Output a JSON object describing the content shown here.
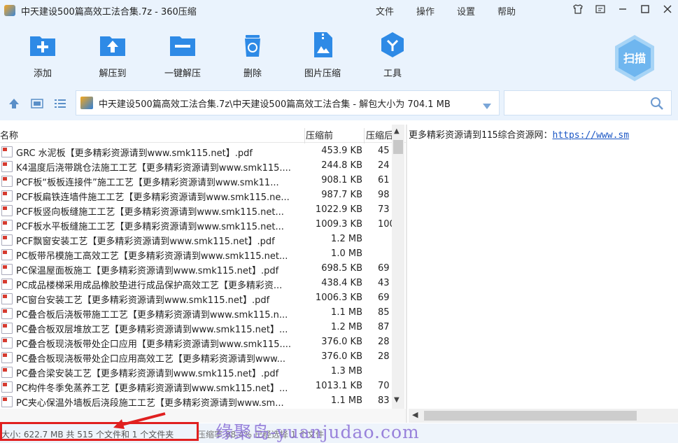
{
  "window": {
    "title": "中天建设500篇高效工法合集.7z - 360压缩"
  },
  "menu": [
    "文件",
    "操作",
    "设置",
    "帮助"
  ],
  "toolbar": {
    "buttons": [
      {
        "label": "添加",
        "icon": "add-icon"
      },
      {
        "label": "解压到",
        "icon": "extract-to-icon"
      },
      {
        "label": "一键解压",
        "icon": "quick-extract-icon"
      },
      {
        "label": "删除",
        "icon": "delete-icon"
      },
      {
        "label": "图片压缩",
        "icon": "image-compress-icon"
      },
      {
        "label": "工具",
        "icon": "tools-icon"
      }
    ],
    "scan_label": "扫描"
  },
  "address": {
    "path": "中天建设500篇高效工法合集.7z\\中天建设500篇高效工法合集 - 解包大小为 704.1 MB",
    "search_value": ""
  },
  "list": {
    "columns": {
      "name": "名称",
      "size": "压缩前",
      "packed": "压缩后"
    },
    "rows": [
      {
        "name": "GRC 水泥板【更多精彩资源请到www.smk115.net】.pdf",
        "size": "453.9 KB",
        "packed": "45"
      },
      {
        "name": "K4温度后浇带跳仓法施工工艺【更多精彩资源请到www.smk115....",
        "size": "244.8 KB",
        "packed": "24"
      },
      {
        "name": "PCF板“板板连接件”施工工艺【更多精彩资源请到www.smk11...",
        "size": "908.1 KB",
        "packed": "61"
      },
      {
        "name": "PCF板扁铁连墙件施工工艺【更多精彩资源请到www.smk115.ne...",
        "size": "987.7 KB",
        "packed": "98"
      },
      {
        "name": "PCF板竖向板缝施工工艺【更多精彩资源请到www.smk115.net...",
        "size": "1022.9 KB",
        "packed": "73"
      },
      {
        "name": "PCF板水平板缝施工工艺【更多精彩资源请到www.smk115.net...",
        "size": "1009.3 KB",
        "packed": "100"
      },
      {
        "name": "PCF飘窗安装工艺【更多精彩资源请到www.smk115.net】.pdf",
        "size": "1.2 MB",
        "packed": ""
      },
      {
        "name": "PC板带吊模施工高效工艺【更多精彩资源请到www.smk115.net...",
        "size": "1.0 MB",
        "packed": ""
      },
      {
        "name": "PC保温屋面板施工【更多精彩资源请到www.smk115.net】.pdf",
        "size": "698.5 KB",
        "packed": "69"
      },
      {
        "name": "PC成品楼梯采用成品橡胶垫进行成品保护高效工艺【更多精彩资...",
        "size": "438.4 KB",
        "packed": "43"
      },
      {
        "name": "PC窗台安装工艺【更多精彩资源请到www.smk115.net】.pdf",
        "size": "1006.3 KB",
        "packed": "69"
      },
      {
        "name": "PC叠合板后浇板带施工工艺【更多精彩资源请到www.smk115.n...",
        "size": "1.1 MB",
        "packed": "85"
      },
      {
        "name": "PC叠合板双层堆放工艺【更多精彩资源请到www.smk115.net】...",
        "size": "1.2 MB",
        "packed": "87"
      },
      {
        "name": "PC叠合板现浇板带处企口应用【更多精彩资源请到www.smk115....",
        "size": "376.0 KB",
        "packed": "28"
      },
      {
        "name": "PC叠合板现浇板带处企口应用高效工艺【更多精彩资源请到www...",
        "size": "376.0 KB",
        "packed": "28"
      },
      {
        "name": "PC叠合梁安装工艺【更多精彩资源请到www.smk115.net】.pdf",
        "size": "1.3 MB",
        "packed": ""
      },
      {
        "name": "PC构件冬季免蒸养工艺【更多精彩资源请到www.smk115.net】...",
        "size": "1013.1 KB",
        "packed": "70"
      },
      {
        "name": "PC夹心保温外墙板后浇段施工工艺【更多精彩资源请到www.sm...",
        "size": "1.1 MB",
        "packed": "83"
      }
    ]
  },
  "preview": {
    "text": "更多精彩资源请到115综合资源网：",
    "link": "https://www.sm"
  },
  "status": {
    "summary": "大小: 622.7 MB 共 515 个文件和 1 个文件夹",
    "extra": "压缩率 88.4% 已经选择 1 个文件"
  },
  "watermark": "缘聚岛-yuanjudao.com",
  "colors": {
    "accent": "#2e8ae6",
    "chrome": "#eaf3fd",
    "annotation": "#e02020",
    "watermark": "#8a6fd6"
  }
}
